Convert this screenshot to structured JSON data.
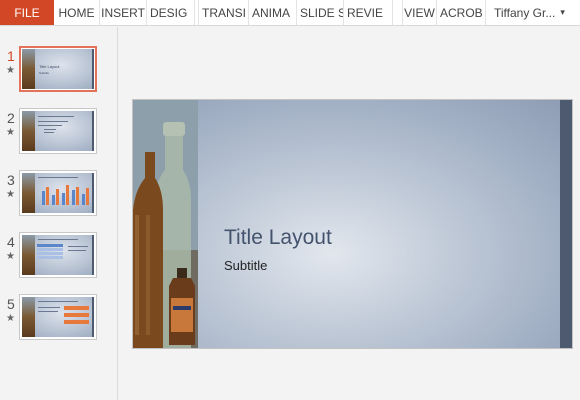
{
  "ribbon": {
    "file": "FILE",
    "tabs": [
      "HOME",
      "INSERT",
      "DESIG",
      "TRANSI",
      "ANIMA",
      "SLIDE S",
      "REVIE",
      "VIEW",
      "ACROB"
    ],
    "user": "Tiffany Gr..."
  },
  "thumbnails": [
    {
      "number": "1",
      "title": "Title Layout",
      "subtitle": "Subtitle",
      "active": true
    },
    {
      "number": "2"
    },
    {
      "number": "3"
    },
    {
      "number": "4"
    },
    {
      "number": "5"
    }
  ],
  "slide": {
    "title": "Title Layout",
    "subtitle": "Subtitle"
  },
  "colors": {
    "file_tab": "#d24726",
    "slide_bar": "#4e5a70",
    "title_text": "#44536d",
    "chart_blue": "#5b86c9",
    "chart_orange": "#e8793c"
  },
  "icons": {
    "animation_marker": "star-icon",
    "user_menu": "caret-down-icon"
  }
}
